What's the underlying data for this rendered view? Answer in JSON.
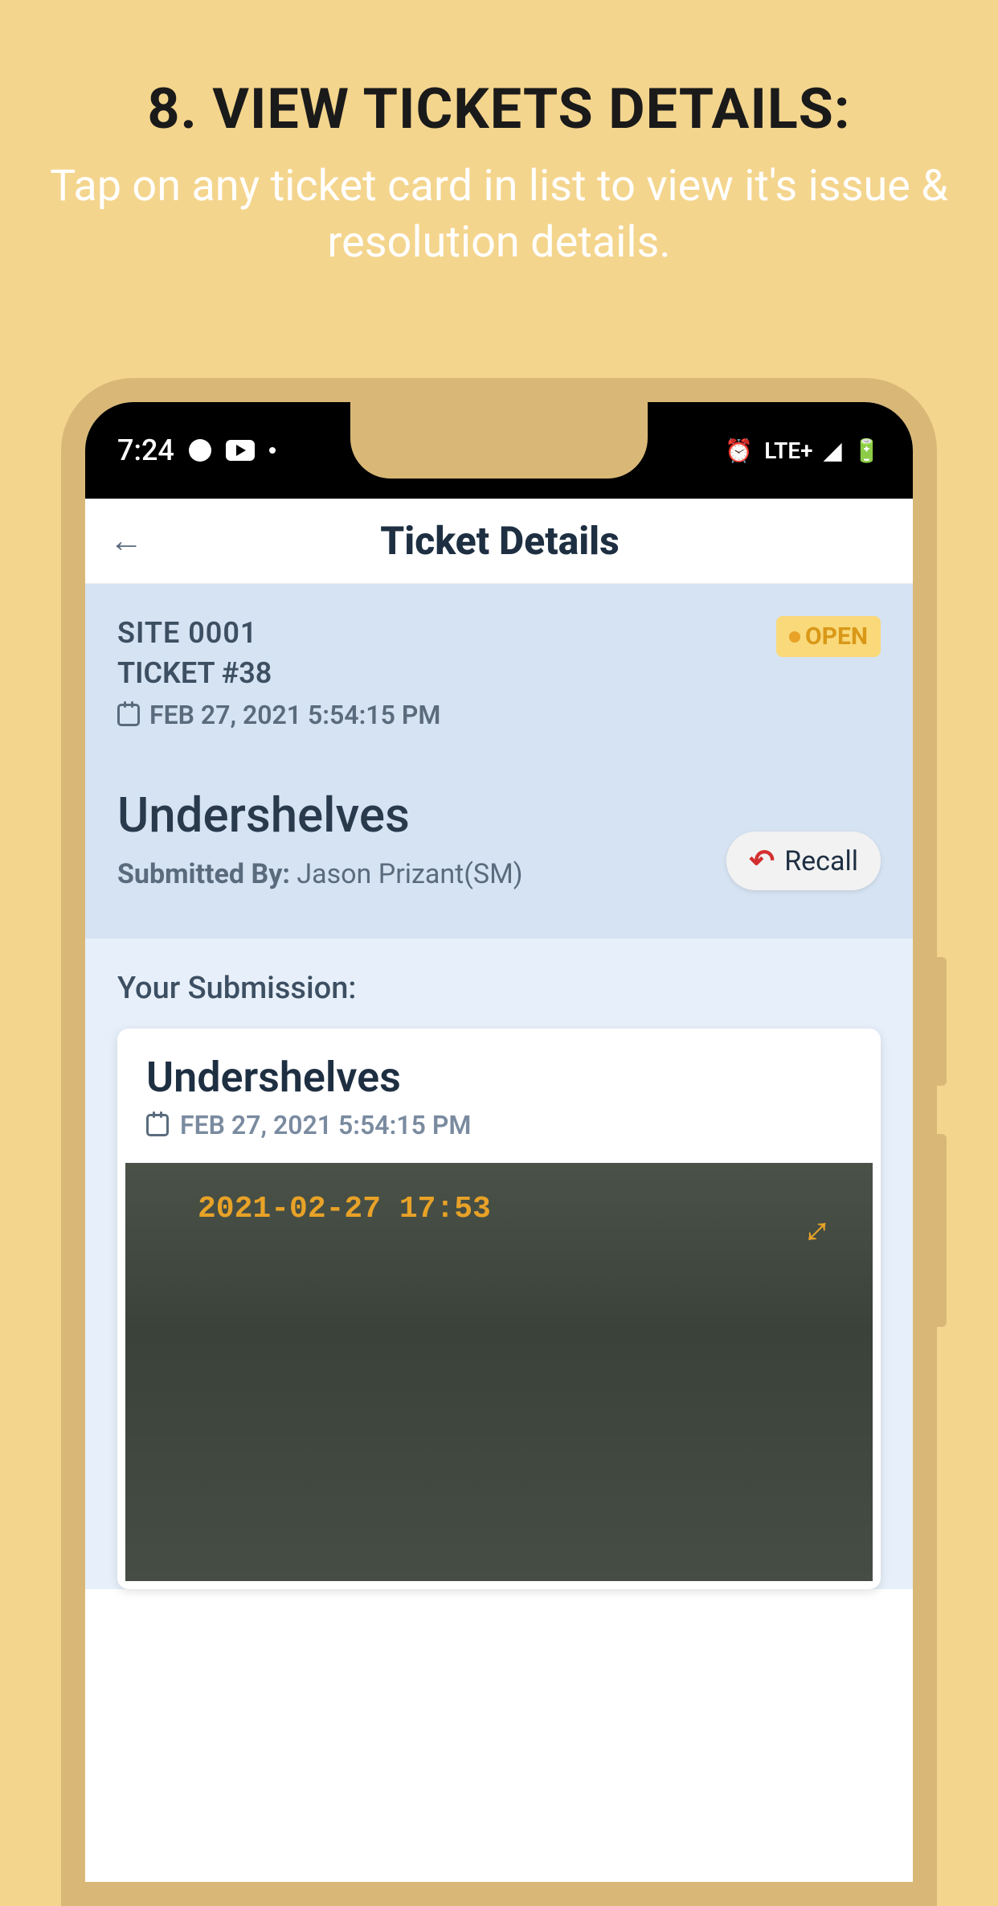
{
  "promo": {
    "title": "8. VIEW TICKETS DETAILS:",
    "subtitle": "Tap on any ticket card in list to view it's issue & resolution details."
  },
  "statusbar": {
    "time": "7:24",
    "network": "LTE+"
  },
  "header": {
    "title": "Ticket Details"
  },
  "ticket": {
    "site": "SITE 0001",
    "ticket_no": "TICKET #38",
    "datetime": "FEB 27, 2021 5:54:15 PM",
    "status": "OPEN",
    "title": "Undershelves",
    "submitted_label": "Submitted By:",
    "submitted_value": " Jason Prizant(SM)",
    "recall_label": "Recall"
  },
  "submission": {
    "label": "Your Submission:",
    "card_title": "Undershelves",
    "card_date": "FEB 27, 2021 5:54:15 PM",
    "image_timestamp": "2021-02-27 17:53"
  }
}
